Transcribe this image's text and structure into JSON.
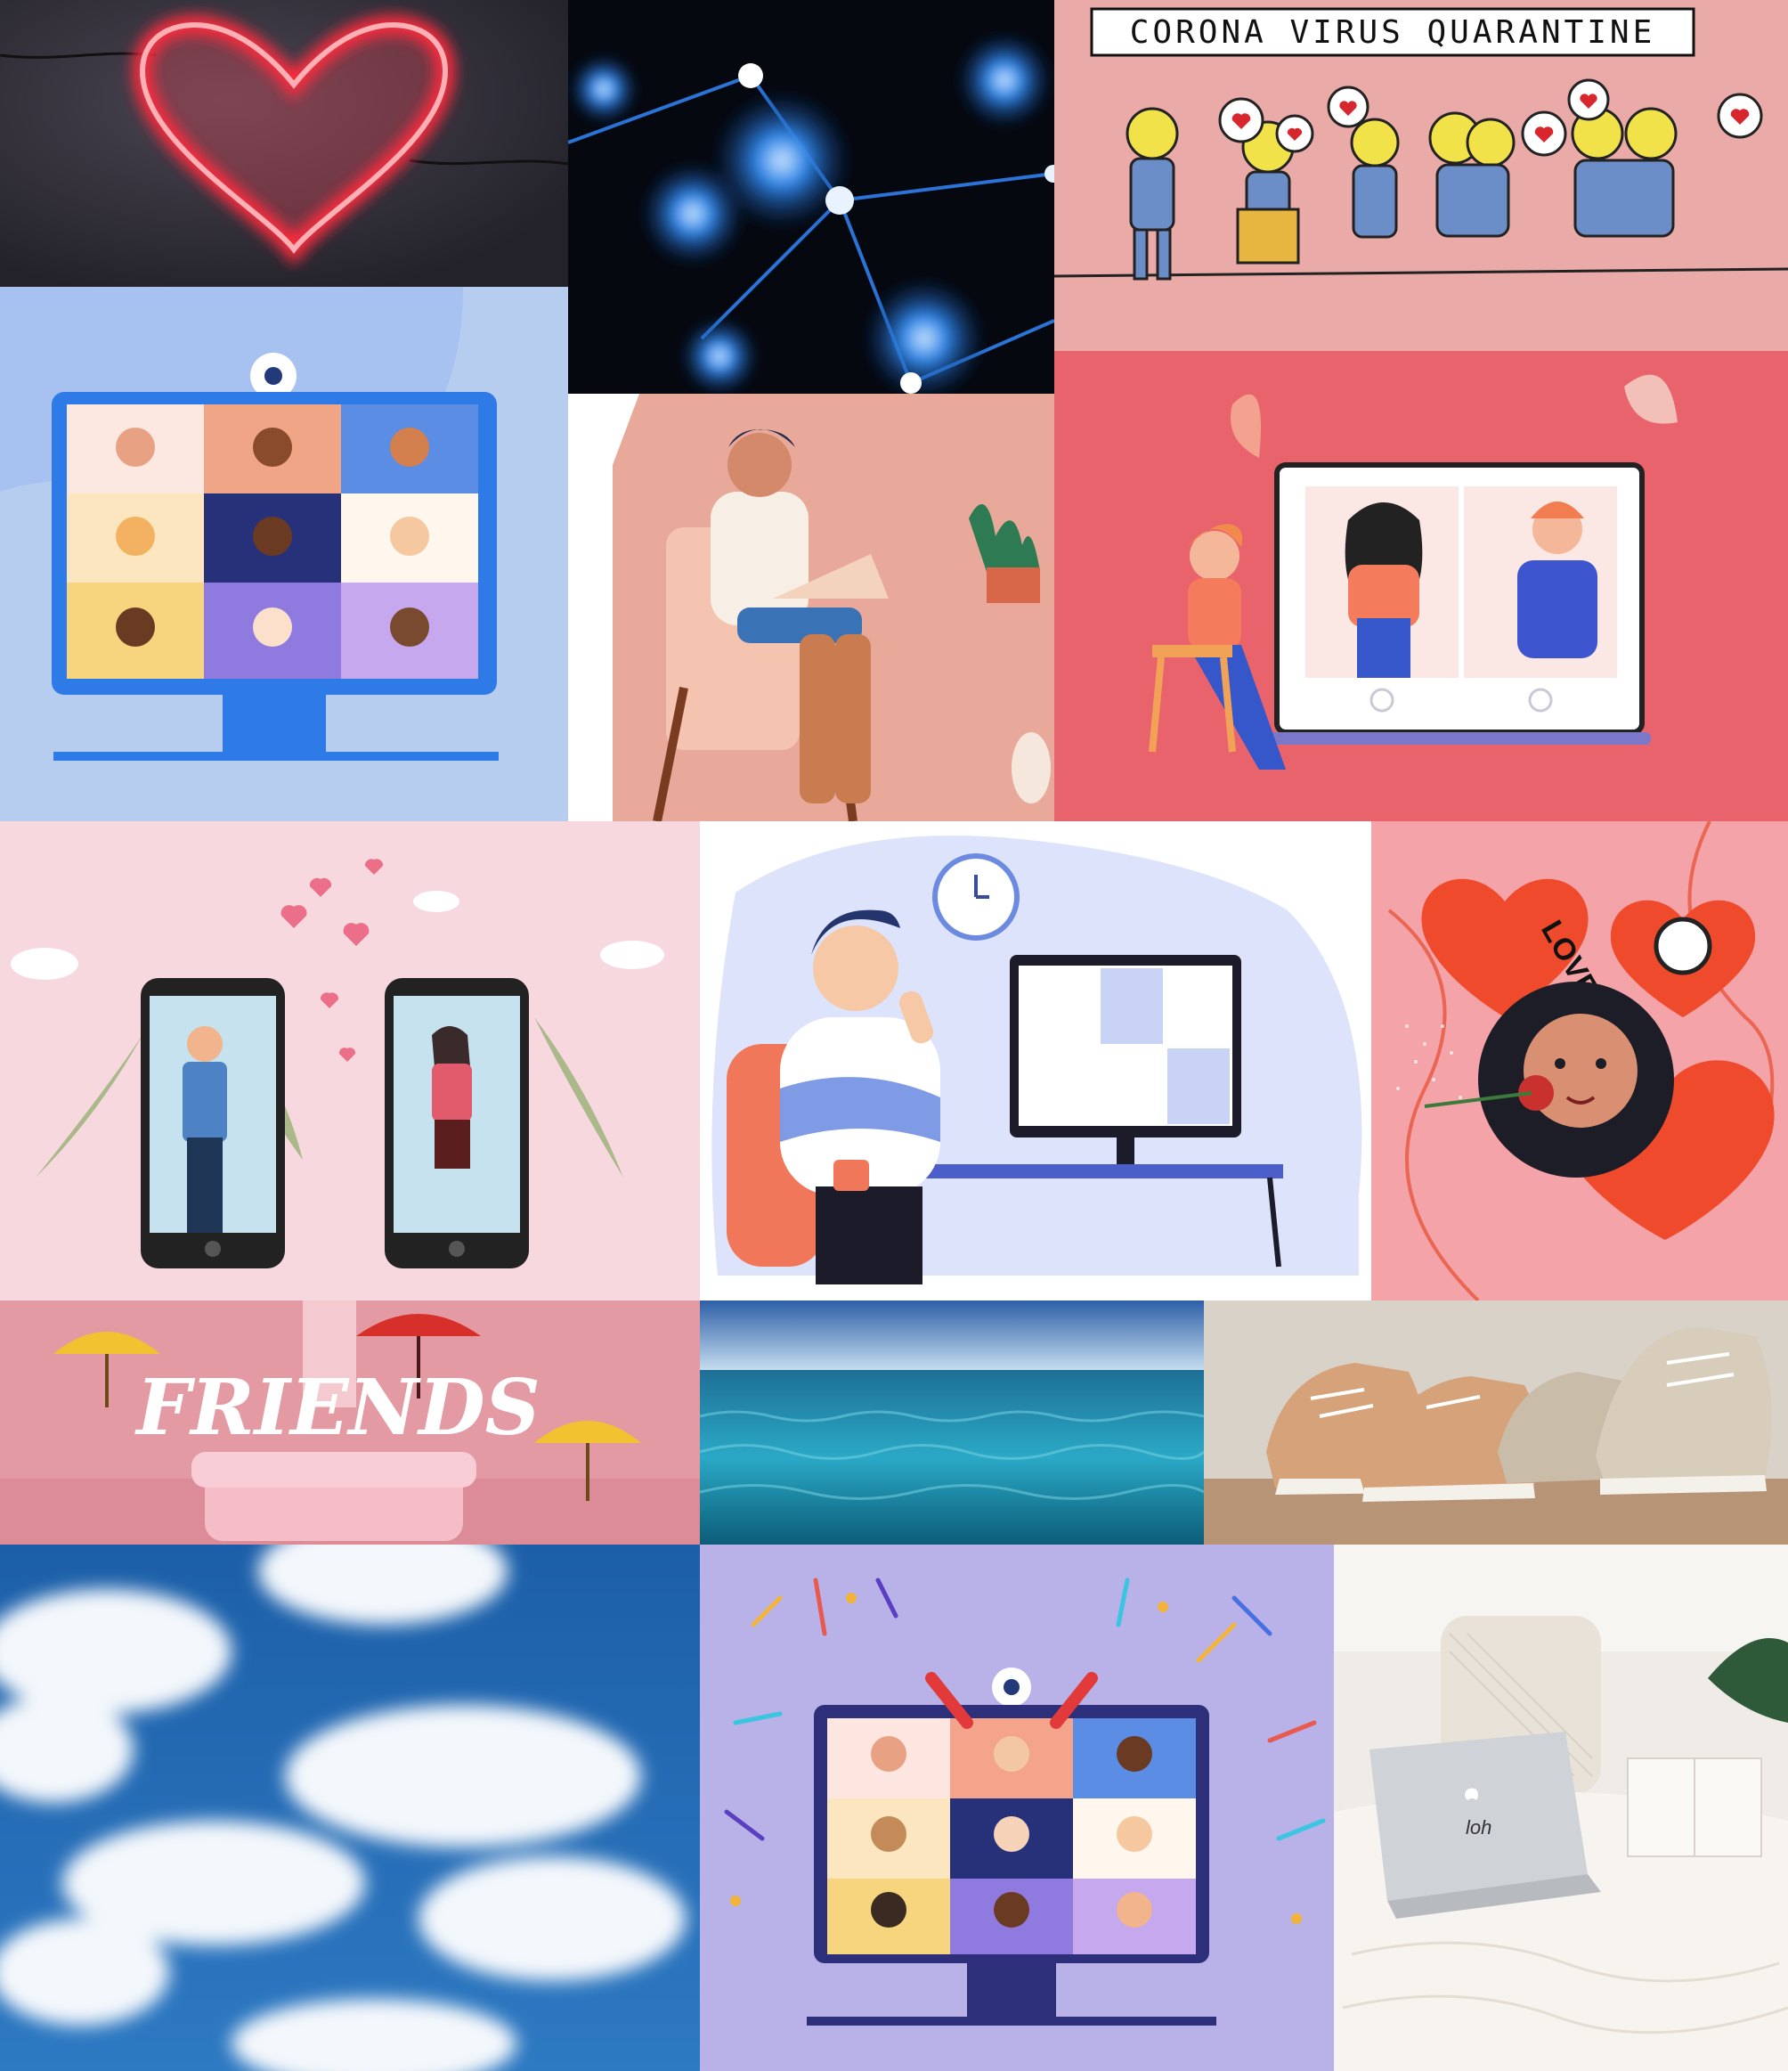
{
  "tiles": {
    "quarantine": {
      "banner": "CORONA VIRUS QUARANTINE"
    },
    "friends": {
      "title": "FRIENDS"
    },
    "love": {
      "text": "LOVE YOU"
    }
  },
  "colors": {
    "neon_red": "#ff3344",
    "zoom_blue": "#2f72e6",
    "quarantine_pink": "#e9aaa8",
    "coral": "#e8636b",
    "sea": "#2aa9c6",
    "sky": "#1f6fb5",
    "lavender": "#b8b2e8"
  }
}
